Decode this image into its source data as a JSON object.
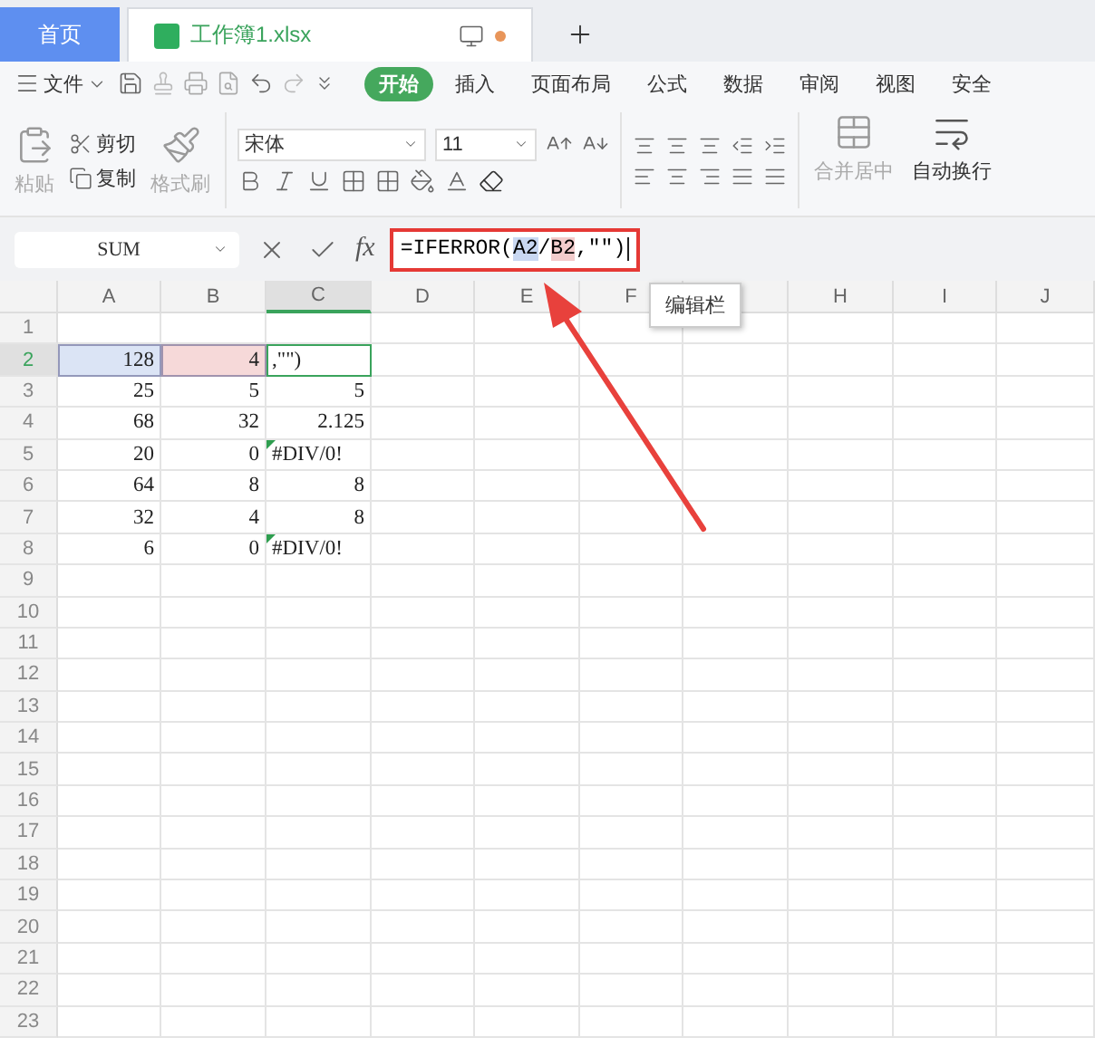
{
  "tabs": [
    {
      "label": "首页",
      "kind": "home",
      "selected": false
    },
    {
      "label": "工作簿1.xlsx",
      "kind": "doc",
      "selected": true,
      "unsaved": true
    }
  ],
  "menu": {
    "file": "文件",
    "items": [
      {
        "label": "开始",
        "selected": true
      },
      {
        "label": "插入",
        "selected": false
      },
      {
        "label": "页面布局",
        "selected": false
      },
      {
        "label": "公式",
        "selected": false
      },
      {
        "label": "数据",
        "selected": false
      },
      {
        "label": "审阅",
        "selected": false
      },
      {
        "label": "视图",
        "selected": false
      },
      {
        "label": "安全",
        "selected": false
      }
    ]
  },
  "ribbon": {
    "paste": {
      "label": "粘贴",
      "disabled": true
    },
    "cut": {
      "label": "剪切",
      "disabled": false
    },
    "copy": {
      "label": "复制",
      "disabled": false
    },
    "format_painter": {
      "label": "格式刷",
      "disabled": true
    },
    "font": {
      "name": "宋体",
      "size": "11"
    },
    "merge": {
      "label": "合并居中",
      "disabled": true
    },
    "wrap": {
      "label": "自动换行",
      "disabled": false
    }
  },
  "formula_bar": {
    "name_box": "SUM",
    "fx": "fx",
    "segments": [
      {
        "text": "=IFERROR("
      },
      {
        "text": "A2",
        "color": "#c9d8f2"
      },
      {
        "text": "/"
      },
      {
        "text": "B2",
        "color": "#f3cccc"
      },
      {
        "text": ",\"\")"
      }
    ]
  },
  "tooltip": "编辑栏",
  "columns": [
    {
      "label": "A",
      "selected": false
    },
    {
      "label": "B",
      "selected": false
    },
    {
      "label": "C",
      "selected": true
    },
    {
      "label": "D",
      "selected": false
    },
    {
      "label": "E",
      "selected": false
    },
    {
      "label": "F",
      "selected": false
    },
    {
      "selected": false
    },
    {
      "label": "H",
      "selected": false
    },
    {
      "label": "I",
      "selected": false
    },
    {
      "label": "J",
      "selected": false
    }
  ],
  "rows": [
    {
      "header": "1",
      "selected": false,
      "cells": []
    },
    {
      "header": "2",
      "selected": true,
      "cells": [
        {
          "text": "128",
          "kind": "ref",
          "color": "#dbe4f5"
        },
        {
          "text": "4",
          "kind": "ref",
          "color": "#f6d9d9"
        },
        {
          "text": ",\"\")",
          "kind": "editing"
        }
      ]
    },
    {
      "header": "3",
      "selected": false,
      "cells": [
        {
          "text": "25",
          "kind": "number"
        },
        {
          "text": "5",
          "kind": "number"
        },
        {
          "text": "5",
          "kind": "number"
        }
      ]
    },
    {
      "header": "4",
      "selected": false,
      "cells": [
        {
          "text": "68",
          "kind": "number"
        },
        {
          "text": "32",
          "kind": "number"
        },
        {
          "text": "2.125",
          "kind": "number"
        }
      ]
    },
    {
      "header": "5",
      "selected": false,
      "cells": [
        {
          "text": "20",
          "kind": "number"
        },
        {
          "text": "0",
          "kind": "number"
        },
        {
          "text": "#DIV/0!",
          "kind": "error"
        }
      ]
    },
    {
      "header": "6",
      "selected": false,
      "cells": [
        {
          "text": "64",
          "kind": "number"
        },
        {
          "text": "8",
          "kind": "number"
        },
        {
          "text": "8",
          "kind": "number"
        }
      ]
    },
    {
      "header": "7",
      "selected": false,
      "cells": [
        {
          "text": "32",
          "kind": "number"
        },
        {
          "text": "4",
          "kind": "number"
        },
        {
          "text": "8",
          "kind": "number"
        }
      ]
    },
    {
      "header": "8",
      "selected": false,
      "cells": [
        {
          "text": "6",
          "kind": "number"
        },
        {
          "text": "0",
          "kind": "number"
        },
        {
          "text": "#DIV/0!",
          "kind": "error"
        }
      ]
    },
    {
      "header": "9",
      "selected": false,
      "cells": []
    },
    {
      "header": "10",
      "selected": false,
      "cells": []
    },
    {
      "header": "11",
      "selected": false,
      "cells": []
    },
    {
      "header": "12",
      "selected": false,
      "cells": []
    },
    {
      "header": "13",
      "selected": false,
      "cells": []
    },
    {
      "header": "14",
      "selected": false,
      "cells": []
    },
    {
      "header": "15",
      "selected": false,
      "cells": []
    },
    {
      "header": "16",
      "selected": false,
      "cells": []
    },
    {
      "header": "17",
      "selected": false,
      "cells": []
    },
    {
      "header": "18",
      "selected": false,
      "cells": []
    },
    {
      "header": "19",
      "selected": false,
      "cells": []
    },
    {
      "header": "20",
      "selected": false,
      "cells": []
    },
    {
      "header": "21",
      "selected": false,
      "cells": []
    },
    {
      "header": "22",
      "selected": false,
      "cells": []
    },
    {
      "header": "23",
      "selected": false,
      "cells": []
    }
  ]
}
